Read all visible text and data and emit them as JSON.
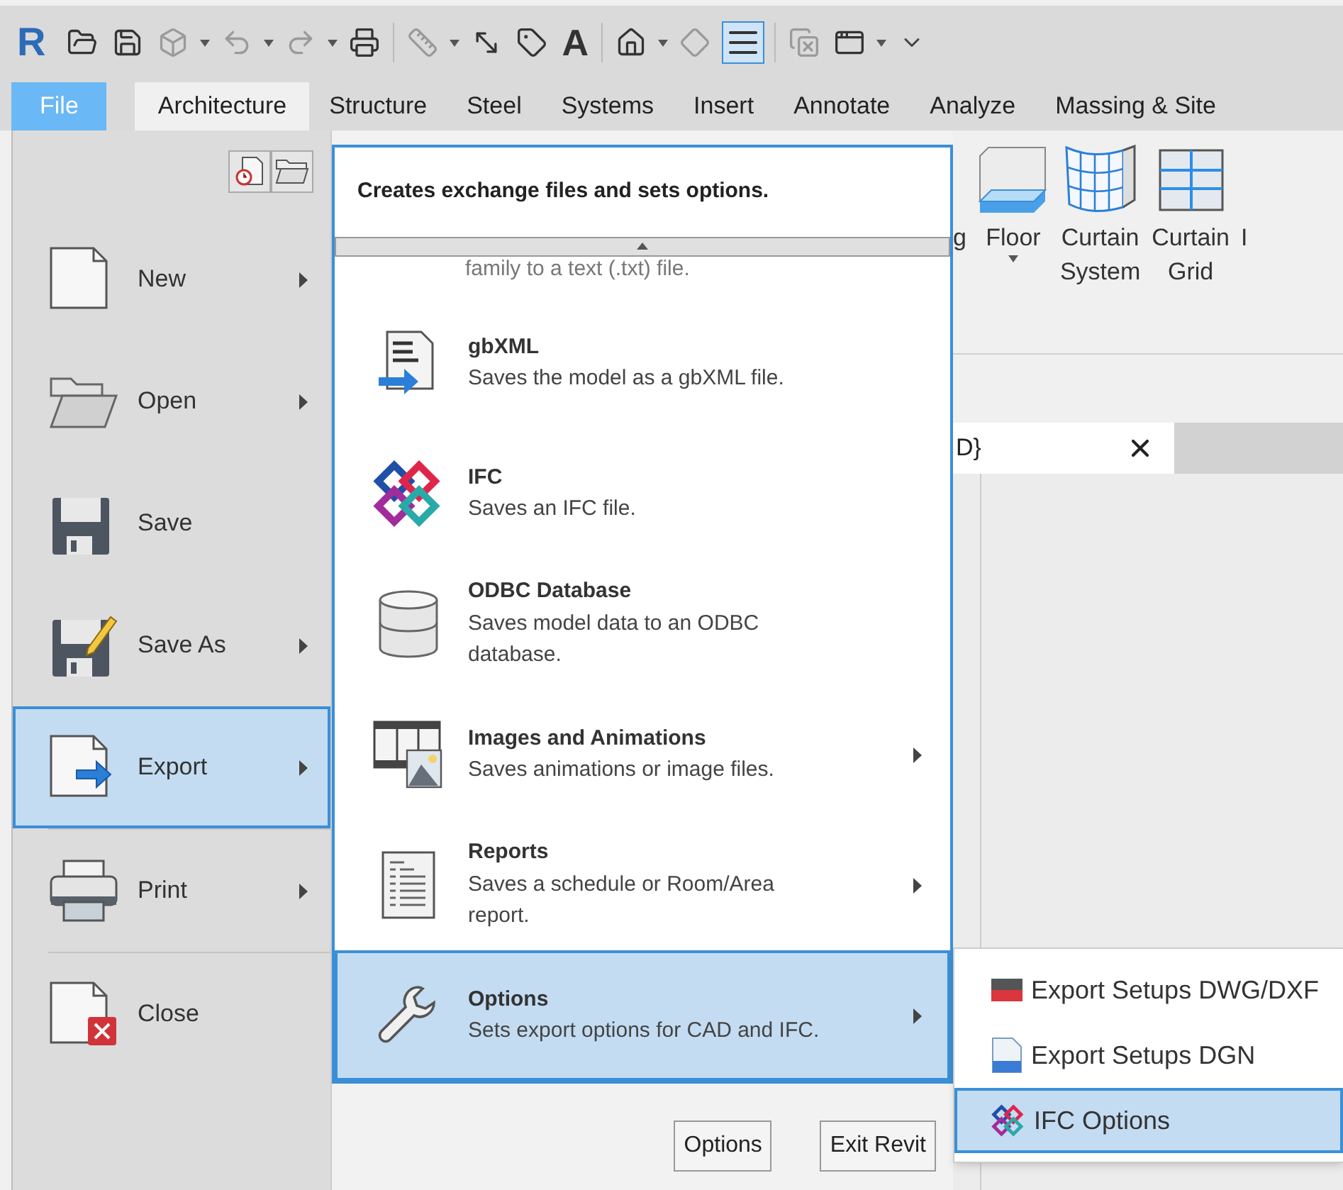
{
  "toolbar": {
    "logo": "R",
    "text_tool": "A",
    "thin_lines_selected": true
  },
  "tabs": [
    {
      "label": "File",
      "kind": "application",
      "selected": false
    },
    {
      "label": "Architecture",
      "kind": "ribbon",
      "selected": true
    },
    {
      "label": "Structure",
      "kind": "ribbon",
      "selected": false
    },
    {
      "label": "Steel",
      "kind": "ribbon",
      "selected": false
    },
    {
      "label": "Systems",
      "kind": "ribbon",
      "selected": false
    },
    {
      "label": "Insert",
      "kind": "ribbon",
      "selected": false
    },
    {
      "label": "Annotate",
      "kind": "ribbon",
      "selected": false
    },
    {
      "label": "Analyze",
      "kind": "ribbon",
      "selected": false
    },
    {
      "label": "Massing & Site",
      "kind": "ribbon",
      "selected": false
    }
  ],
  "ribbon": {
    "buttons": [
      {
        "label": "g",
        "kind": "partial",
        "dropdown": false
      },
      {
        "label": "Floor",
        "kind": "floor",
        "dropdown": true
      },
      {
        "label": "Curtain System",
        "kind": "curtain-system",
        "dropdown": false
      },
      {
        "label": "Curtain Grid",
        "kind": "curtain-grid",
        "dropdown": false
      },
      {
        "label": "I",
        "kind": "partial",
        "dropdown": false
      }
    ]
  },
  "view_tab": {
    "label": "D}"
  },
  "app_menu": {
    "items": [
      {
        "label": "New",
        "kind": "new",
        "submenu": true,
        "selected": false
      },
      {
        "label": "Open",
        "kind": "open",
        "submenu": true,
        "selected": false
      },
      {
        "label": "Save",
        "kind": "save",
        "submenu": false,
        "selected": false
      },
      {
        "label": "Save As",
        "kind": "save-as",
        "submenu": true,
        "selected": false
      },
      {
        "label": "Export",
        "kind": "export",
        "submenu": true,
        "selected": true
      },
      {
        "label": "Print",
        "kind": "print",
        "submenu": true,
        "selected": false
      },
      {
        "label": "Close",
        "kind": "close",
        "submenu": false,
        "selected": false
      }
    ]
  },
  "export_panel": {
    "title": "Creates exchange files and sets options.",
    "cut_off_text": "family to a text (.txt) file.",
    "items": [
      {
        "kind": "gbxml",
        "title": "gbXML",
        "description": [
          "Saves the model as a gbXML file."
        ],
        "submenu": false,
        "selected": false
      },
      {
        "kind": "ifc",
        "title": "IFC",
        "description": [
          "Saves an IFC file."
        ],
        "submenu": false,
        "selected": false
      },
      {
        "kind": "odbc",
        "title": "ODBC Database",
        "description": [
          "Saves model data to an ODBC",
          "database."
        ],
        "submenu": false,
        "selected": false
      },
      {
        "kind": "images",
        "title": "Images and Animations",
        "description": [
          "Saves animations or image files."
        ],
        "submenu": true,
        "selected": false
      },
      {
        "kind": "reports",
        "title": "Reports",
        "description": [
          "Saves a schedule or Room/Area",
          "report."
        ],
        "submenu": true,
        "selected": false
      },
      {
        "kind": "options",
        "title": "Options",
        "description": [
          "Sets export options for CAD and IFC."
        ],
        "submenu": true,
        "selected": true
      }
    ]
  },
  "flyout": {
    "items": [
      {
        "kind": "dwg",
        "label": "Export Setups DWG/DXF",
        "selected": false
      },
      {
        "kind": "dgn",
        "label": "Export Setups DGN",
        "selected": false
      },
      {
        "kind": "ifc",
        "label": "IFC Options",
        "selected": true
      }
    ]
  },
  "buttons": [
    "Options",
    "Exit Revit"
  ]
}
